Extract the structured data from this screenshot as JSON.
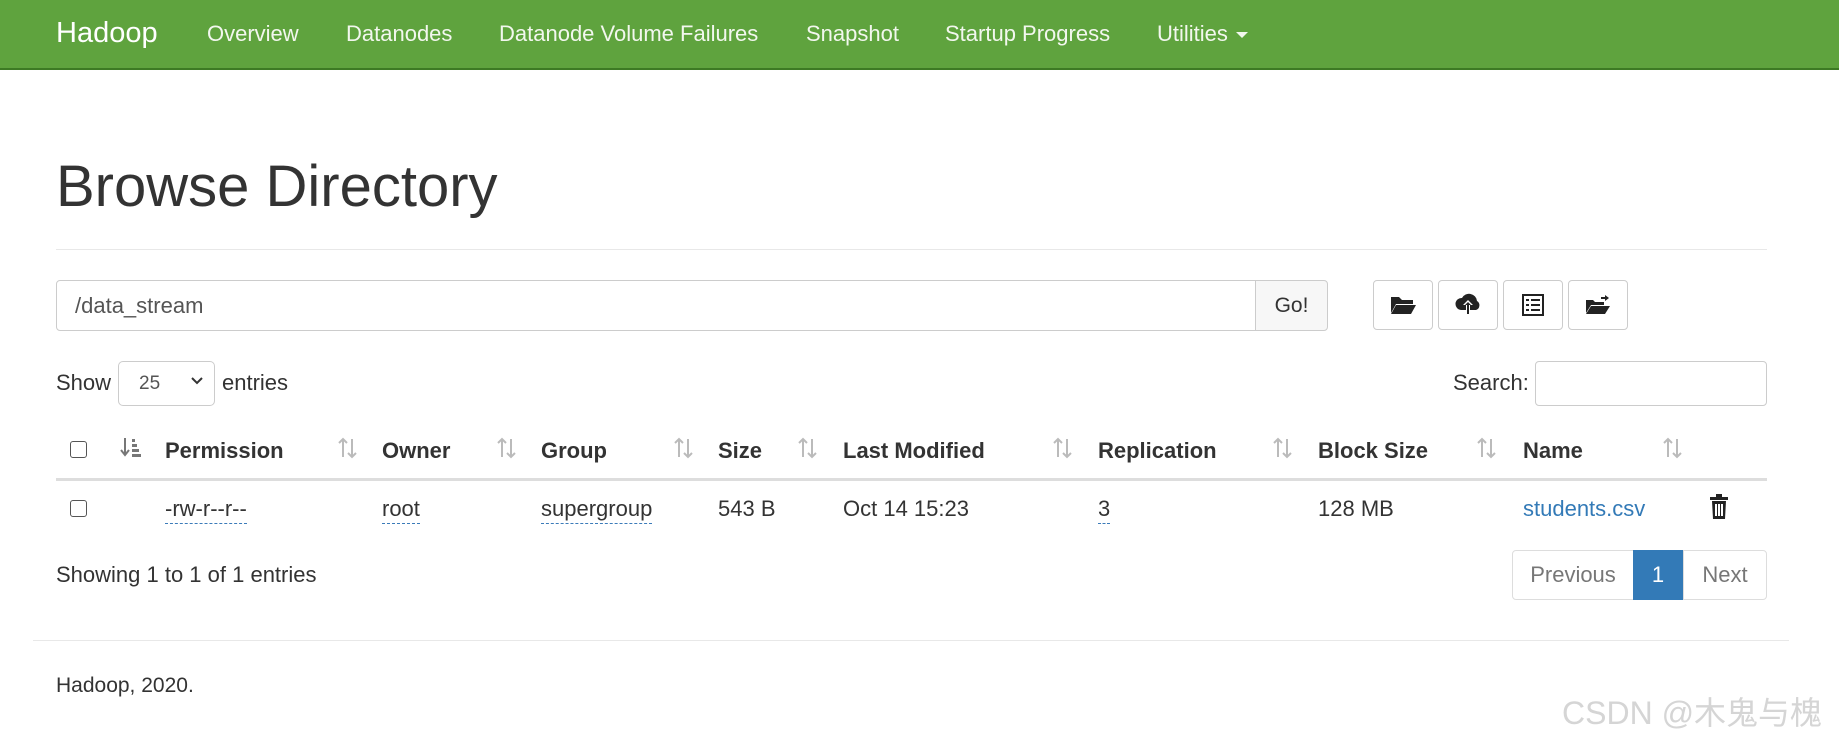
{
  "navbar": {
    "brand": "Hadoop",
    "items": [
      "Overview",
      "Datanodes",
      "Datanode Volume Failures",
      "Snapshot",
      "Startup Progress",
      "Utilities"
    ]
  },
  "page": {
    "title": "Browse Directory"
  },
  "path_bar": {
    "path": "/data_stream",
    "go_label": "Go!"
  },
  "toolbar_icons": [
    "folder-open-icon",
    "cloud-upload-icon",
    "list-icon",
    "folder-move-icon"
  ],
  "entries": {
    "show_label": "Show",
    "selected": "25",
    "entries_label": "entries"
  },
  "search": {
    "label": "Search:",
    "value": ""
  },
  "table": {
    "columns": [
      "Permission",
      "Owner",
      "Group",
      "Size",
      "Last Modified",
      "Replication",
      "Block Size",
      "Name"
    ],
    "rows": [
      {
        "permission": "-rw-r--r--",
        "owner": "root",
        "group": "supergroup",
        "size": "543 B",
        "last_modified": "Oct 14 15:23",
        "replication": "3",
        "block_size": "128 MB",
        "name": "students.csv"
      }
    ]
  },
  "pagination": {
    "info": "Showing 1 to 1 of 1 entries",
    "previous": "Previous",
    "current": "1",
    "next": "Next"
  },
  "footer": {
    "text": "Hadoop, 2020."
  },
  "watermark": "CSDN @木鬼与槐",
  "colors": {
    "navbar": "#5fa33e",
    "link": "#337ab7",
    "active_page": "#337ab7"
  }
}
